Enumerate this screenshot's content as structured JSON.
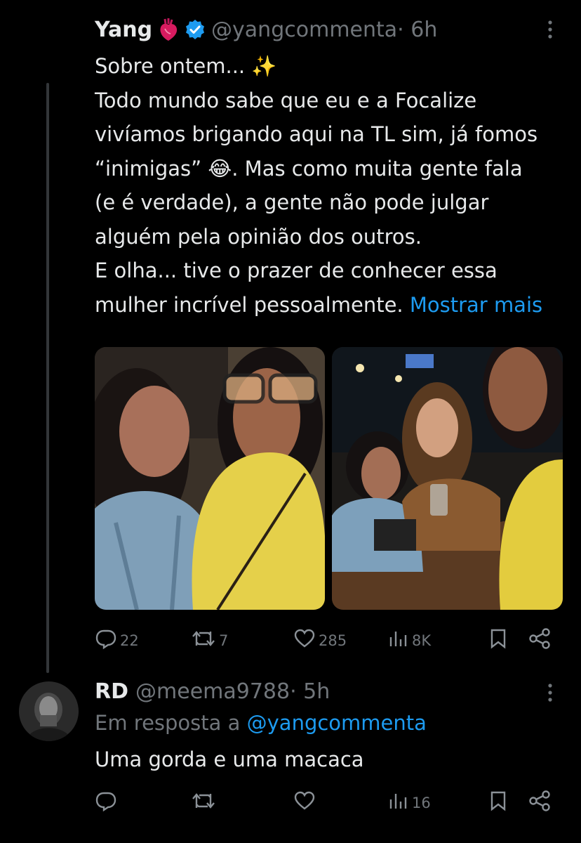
{
  "tweet": {
    "author_name": "Yang",
    "emoji_name": "🫀",
    "handle": "@yangcommenta",
    "time": " · 6h",
    "text_line1": "Sobre ontem... ✨",
    "body_part1": "Todo mundo sabe que eu e a Focalize vivíamos brigando aqui na TL  sim, já fomos “inimigas” 😂. Mas como muita gente fala (e é verdade), a gente não pode julgar alguém pela opinião dos outros.",
    "body_part2": "E olha... tive o prazer de conhecer essa mulher incrível pessoalmente.",
    "show_more": "Mostrar mais",
    "stats": {
      "replies": "22",
      "retweets": "7",
      "likes": "285",
      "views": "8K"
    }
  },
  "reply": {
    "author_name": "RD",
    "handle": "@meema9788",
    "time": " · 5h",
    "in_reply_prefix": "Em resposta a ",
    "in_reply_handle": "@yangcommenta",
    "text": "Uma gorda e uma macaca",
    "stats": {
      "views": "16"
    }
  },
  "colors": {
    "accent": "#1d9bf0",
    "muted": "#71767b",
    "background": "#000000",
    "verified": "#1d9bf0"
  },
  "icons": [
    "verified-badge-icon",
    "more-options-icon",
    "reply-icon",
    "retweet-icon",
    "like-icon",
    "views-icon",
    "bookmark-icon",
    "share-icon"
  ]
}
